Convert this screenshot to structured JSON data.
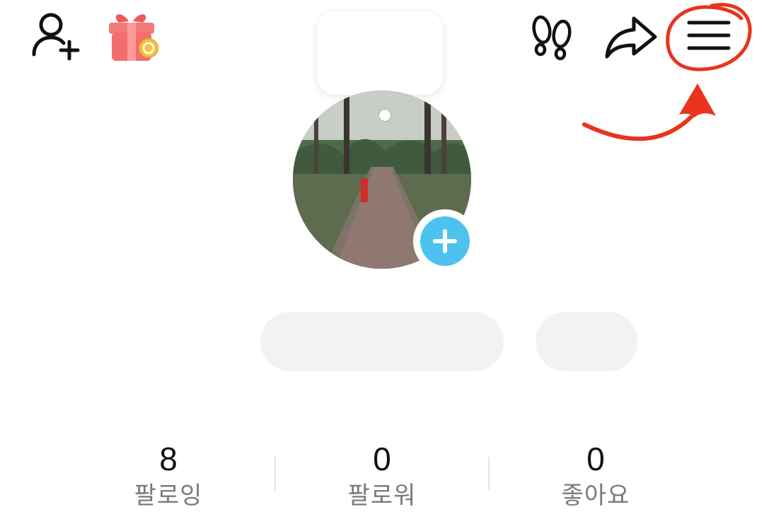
{
  "header": {
    "icons": {
      "add_friend": "add-person-icon",
      "gift": "gift-icon",
      "footprints": "footprints-icon",
      "share": "share-arrow-icon",
      "menu": "hamburger-menu-icon"
    }
  },
  "profile": {
    "status_bubble_text": "",
    "avatar_add_icon": "plus-icon",
    "nickname": "",
    "extra_button": ""
  },
  "stats": [
    {
      "value": "8",
      "label": "팔로잉"
    },
    {
      "value": "0",
      "label": "팔로워"
    },
    {
      "value": "0",
      "label": "좋아요"
    }
  ],
  "annotation": {
    "color": "#e8341c",
    "target": "hamburger-menu-icon"
  },
  "colors": {
    "accent": "#4cc3ef",
    "pill_bg": "#f2f2f2",
    "label_gray": "#7a7a7a"
  }
}
